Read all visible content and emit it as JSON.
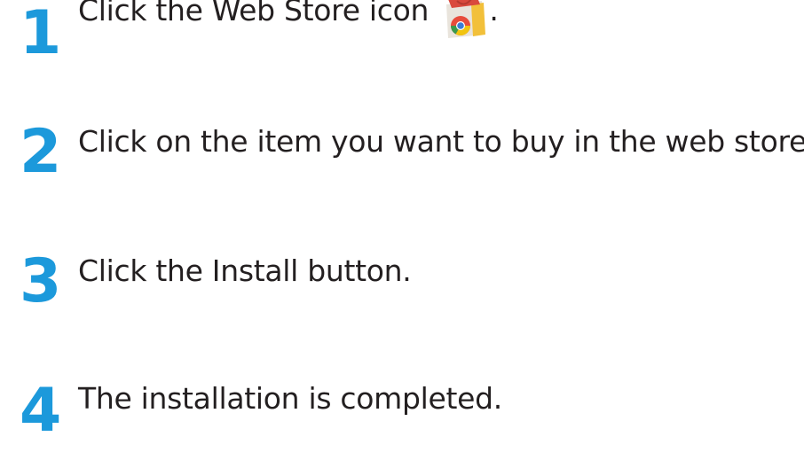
{
  "steps": [
    {
      "number": "1",
      "text": "Click the Web Store icon",
      "suffix": ".",
      "icon": "chrome-web-store-icon"
    },
    {
      "number": "2",
      "text": "Click on the item you want to buy in the web store."
    },
    {
      "number": "3",
      "text": "Click the Install button."
    },
    {
      "number": "4",
      "text": "The installation is completed."
    }
  ],
  "colors": {
    "step_number": "#1c99db",
    "body_text": "#231f20"
  }
}
